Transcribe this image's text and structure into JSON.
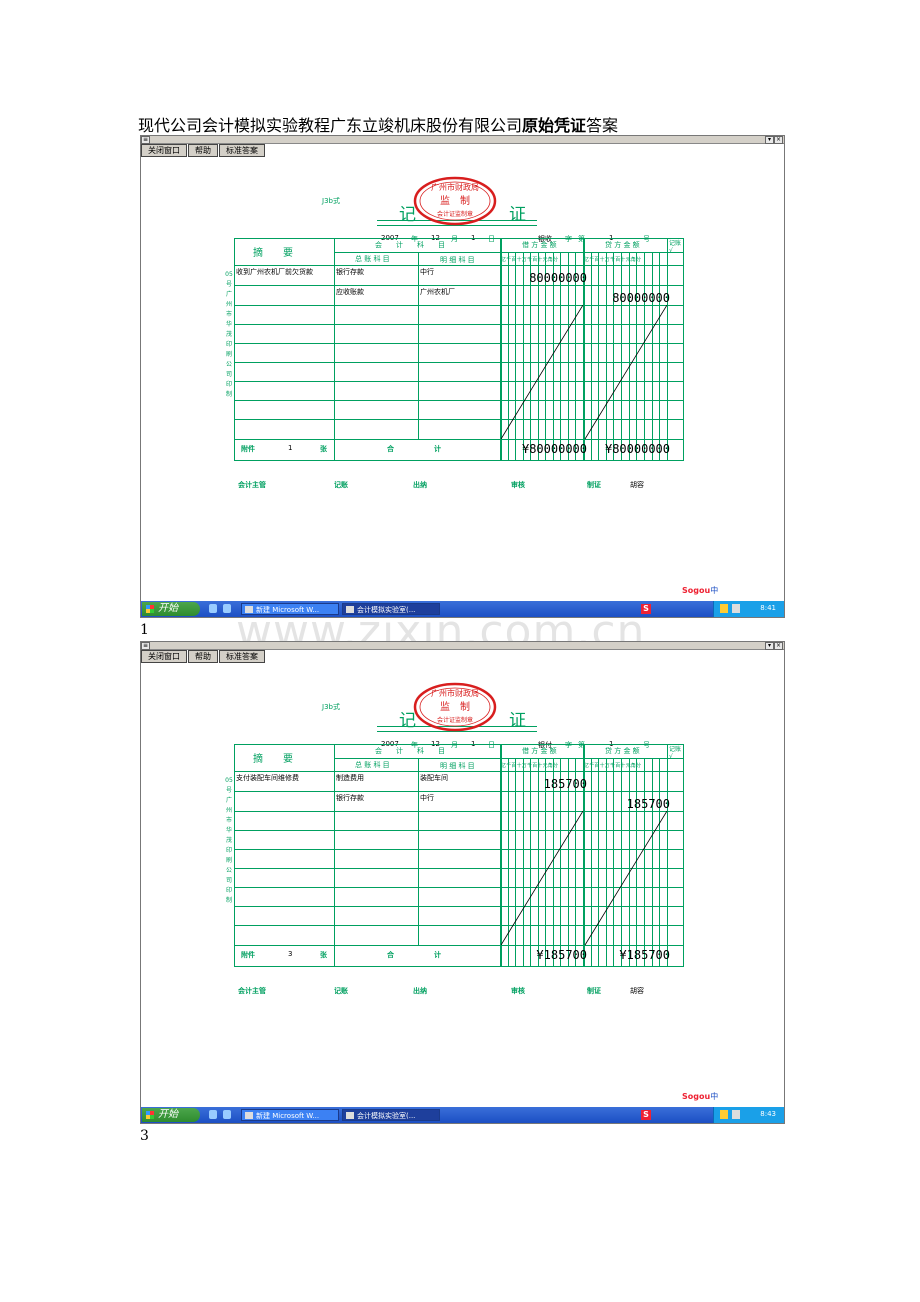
{
  "document": {
    "title_prefix": "现代公司会计模拟实验教程广东立竣机床股份有限公司",
    "title_bold": "原始凭证",
    "title_suffix": "答案"
  },
  "watermark": "www.zixin.com.cn",
  "toolbar": {
    "close": "关闭窗口",
    "help": "帮助",
    "answer": "标准答案"
  },
  "form_labels": {
    "form_type": "J3b式",
    "title_left": "记",
    "title_right": "证",
    "year_unit": "年",
    "month_unit": "月",
    "day_unit": "日",
    "zi": "字",
    "di": "第",
    "hao": "号",
    "summary": "摘　　要",
    "account": "会　　计　　科　　目",
    "general_account": "总 账 科 目",
    "detail_account": "明 细 科 目",
    "debit_amount": "借 方 金 额",
    "credit_amount": "贷 方 金 额",
    "posted": "记账√",
    "digits": [
      "亿",
      "千",
      "百",
      "十",
      "万",
      "千",
      "百",
      "十",
      "元",
      "角",
      "分"
    ],
    "attach": "附件",
    "zhang": "张",
    "total_he": "合",
    "total_ji": "计",
    "side_text": "05号 广州市华茂印刷公司印制",
    "supervisor": "会计主管",
    "bookkeeping": "记账",
    "cashier": "出纳",
    "audit": "审核",
    "maker": "制证",
    "maker_name": "胡容"
  },
  "stamp": {
    "top": "广州市财政局",
    "middle": "监　制",
    "bottom": "会计证监制章"
  },
  "screenshots": [
    {
      "page_number": "1",
      "year": "2007",
      "month": "12",
      "day": "1",
      "voucher_type": "银收",
      "voucher_no": "1",
      "summary": "收到广州农机厂前欠货款",
      "row1_general": "银行存款",
      "row1_detail": "中行",
      "row2_general": "应收账款",
      "row2_detail": "广州农机厂",
      "debit": "80000000",
      "credit": "80000000",
      "attachments": "1",
      "total_debit": "¥80000000",
      "total_credit": "¥80000000",
      "clock": "8:41",
      "task1": "新建 Microsoft W...",
      "task2": "会计模拟实验室(..."
    },
    {
      "page_number": "3",
      "year": "2007",
      "month": "12",
      "day": "1",
      "voucher_type": "银付",
      "voucher_no": "1",
      "summary": "支付装配车间维修费",
      "row1_general": "制造费用",
      "row1_detail": "装配车间",
      "row2_general": "银行存款",
      "row2_detail": "中行",
      "debit": "185700",
      "credit": "185700",
      "attachments": "3",
      "total_debit": "¥185700",
      "total_credit": "¥185700",
      "clock": "8:43",
      "task1": "新建 Microsoft W...",
      "task2": "会计模拟实验室(..."
    }
  ],
  "taskbar": {
    "start": "开始"
  },
  "ime": {
    "brand": "Sogou",
    "mode": "中"
  },
  "colors": {
    "form_green": "#00a060",
    "stamp_red": "#d81e1e",
    "taskbar_blue": "#1c4fc4"
  }
}
